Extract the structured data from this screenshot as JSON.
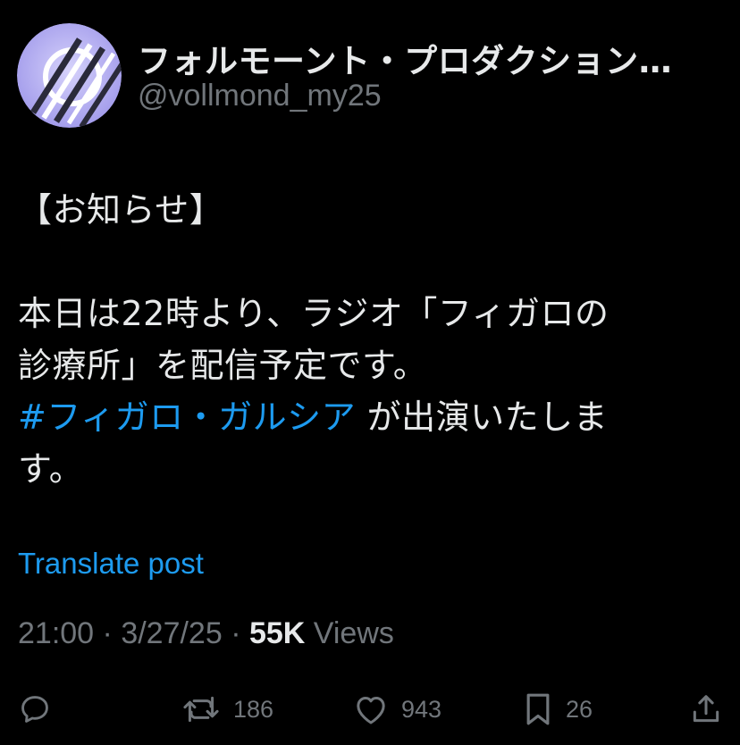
{
  "author": {
    "display_name": "フォルモーント・プロダクション…",
    "handle": "@vollmond_my25"
  },
  "post": {
    "lines": [
      "【お知らせ】",
      "本日は22時より、ラジオ「フィガロの",
      "診療所」を配信予定です。"
    ],
    "hashtag": "#フィガロ・ガルシア",
    "after_hashtag": " が出演いたしま",
    "last_line": "す。"
  },
  "translate_label": "Translate post",
  "meta": {
    "time": "21:00",
    "separator": " · ",
    "date": "3/27/25",
    "views_count": "55K",
    "views_label": " Views"
  },
  "actions": {
    "reply_icon": "reply-icon",
    "repost_icon": "repost-icon",
    "repost_count": "186",
    "like_icon": "heart-icon",
    "like_count": "943",
    "bookmark_icon": "bookmark-icon",
    "bookmark_count": "26",
    "share_icon": "share-icon"
  },
  "colors": {
    "background": "#000000",
    "text": "#e7e9ea",
    "secondary": "#71767b",
    "link": "#1d9bf0",
    "avatar_bg": "#b9b3f2"
  }
}
